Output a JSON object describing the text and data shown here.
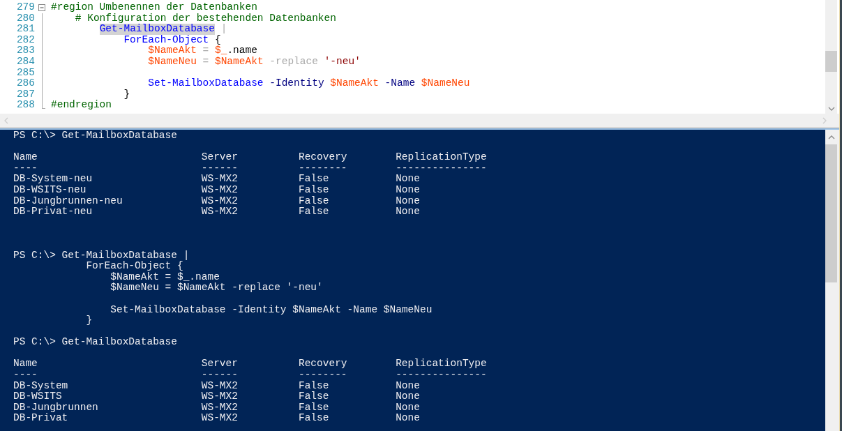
{
  "editor": {
    "fold_region": {
      "expanded": true
    },
    "lines": [
      {
        "number": "279",
        "tokens": [
          {
            "text": "#region Umbenennen der Datenbanken",
            "kind": "comment"
          }
        ]
      },
      {
        "number": "280",
        "tokens": [
          {
            "text": "    # Konfiguration der bestehenden Datenbanken",
            "kind": "comment"
          }
        ]
      },
      {
        "number": "281",
        "tokens": [
          {
            "text": "        Get-MailboxDatabase",
            "kind": "cmdlet",
            "selected": true
          },
          {
            "text": " |",
            "kind": "operator"
          }
        ]
      },
      {
        "number": "282",
        "tokens": [
          {
            "text": "            ForEach-Object",
            "kind": "cmdlet"
          },
          {
            "text": " {",
            "kind": "plain"
          }
        ]
      },
      {
        "number": "283",
        "tokens": [
          {
            "text": "                $NameAkt",
            "kind": "variable"
          },
          {
            "text": " = ",
            "kind": "operator"
          },
          {
            "text": "$_",
            "kind": "variable"
          },
          {
            "text": ".name",
            "kind": "plain"
          }
        ]
      },
      {
        "number": "284",
        "tokens": [
          {
            "text": "                $NameNeu",
            "kind": "variable"
          },
          {
            "text": " = ",
            "kind": "operator"
          },
          {
            "text": "$NameAkt",
            "kind": "variable"
          },
          {
            "text": " -replace ",
            "kind": "operator"
          },
          {
            "text": "'-neu'",
            "kind": "string"
          }
        ]
      },
      {
        "number": "285"
      },
      {
        "number": "286",
        "tokens": [
          {
            "text": "                Set-MailboxDatabase",
            "kind": "cmdlet"
          },
          {
            "text": " -Identity ",
            "kind": "parameter"
          },
          {
            "text": "$NameAkt",
            "kind": "variable"
          },
          {
            "text": " -Name ",
            "kind": "parameter"
          },
          {
            "text": "$NameNeu",
            "kind": "variable"
          }
        ]
      },
      {
        "number": "287",
        "tokens": [
          {
            "text": "            }",
            "kind": "plain"
          }
        ]
      },
      {
        "number": "288",
        "tokens": [
          {
            "text": "#endregion",
            "kind": "comment"
          }
        ]
      }
    ]
  },
  "console": {
    "blocks": [
      {
        "kind": "command",
        "lines": [
          {
            "text": "PS C:\\> Get-MailboxDatabase"
          }
        ]
      },
      {
        "kind": "table",
        "columns": [
          "Name",
          "Server",
          "Recovery",
          "ReplicationType"
        ],
        "separators": [
          "----",
          "------",
          "--------",
          "---------------"
        ],
        "rows": [
          [
            "DB-System-neu",
            "WS-MX2",
            "False",
            "None"
          ],
          [
            "DB-WSITS-neu",
            "WS-MX2",
            "False",
            "None"
          ],
          [
            "DB-Jungbrunnen-neu",
            "WS-MX2",
            "False",
            "None"
          ],
          [
            "DB-Privat-neu",
            "WS-MX2",
            "False",
            "None"
          ]
        ]
      },
      {
        "kind": "command",
        "lines": [
          {
            "text": "PS C:\\> Get-MailboxDatabase |"
          },
          {
            "text": "            ForEach-Object {"
          },
          {
            "text": "                $NameAkt = $_.name"
          },
          {
            "text": "                $NameNeu = $NameAkt -replace '-neu'"
          },
          {
            "text": "                Set-MailboxDatabase -Identity $NameAkt -Name $NameNeu",
            "gap_before": true
          },
          {
            "text": "            }"
          }
        ]
      },
      {
        "kind": "command",
        "lines": [
          {
            "text": "PS C:\\> Get-MailboxDatabase"
          }
        ]
      },
      {
        "kind": "table",
        "columns": [
          "Name",
          "Server",
          "Recovery",
          "ReplicationType"
        ],
        "separators": [
          "----",
          "------",
          "--------",
          "---------------"
        ],
        "rows": [
          [
            "DB-System",
            "WS-MX2",
            "False",
            "None"
          ],
          [
            "DB-WSITS",
            "WS-MX2",
            "False",
            "None"
          ],
          [
            "DB-Jungbrunnen",
            "WS-MX2",
            "False",
            "None"
          ],
          [
            "DB-Privat",
            "WS-MX2",
            "False",
            "None"
          ]
        ]
      }
    ]
  }
}
